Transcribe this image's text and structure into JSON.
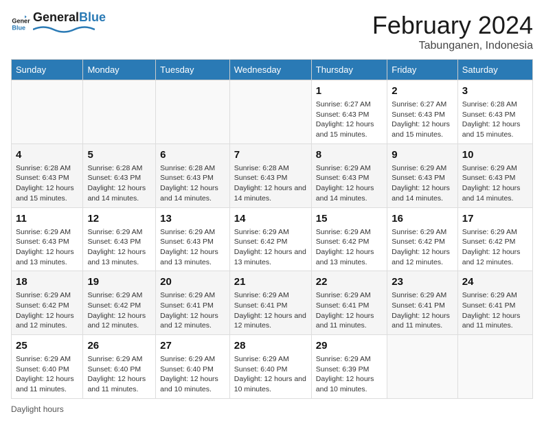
{
  "logo": {
    "text_general": "General",
    "text_blue": "Blue"
  },
  "title": "February 2024",
  "subtitle": "Tabunganen, Indonesia",
  "days_of_week": [
    "Sunday",
    "Monday",
    "Tuesday",
    "Wednesday",
    "Thursday",
    "Friday",
    "Saturday"
  ],
  "footer_text": "Daylight hours",
  "weeks": [
    [
      {
        "day": "",
        "info": ""
      },
      {
        "day": "",
        "info": ""
      },
      {
        "day": "",
        "info": ""
      },
      {
        "day": "",
        "info": ""
      },
      {
        "day": "1",
        "info": "Sunrise: 6:27 AM\nSunset: 6:43 PM\nDaylight: 12 hours and 15 minutes."
      },
      {
        "day": "2",
        "info": "Sunrise: 6:27 AM\nSunset: 6:43 PM\nDaylight: 12 hours and 15 minutes."
      },
      {
        "day": "3",
        "info": "Sunrise: 6:28 AM\nSunset: 6:43 PM\nDaylight: 12 hours and 15 minutes."
      }
    ],
    [
      {
        "day": "4",
        "info": "Sunrise: 6:28 AM\nSunset: 6:43 PM\nDaylight: 12 hours and 15 minutes."
      },
      {
        "day": "5",
        "info": "Sunrise: 6:28 AM\nSunset: 6:43 PM\nDaylight: 12 hours and 14 minutes."
      },
      {
        "day": "6",
        "info": "Sunrise: 6:28 AM\nSunset: 6:43 PM\nDaylight: 12 hours and 14 minutes."
      },
      {
        "day": "7",
        "info": "Sunrise: 6:28 AM\nSunset: 6:43 PM\nDaylight: 12 hours and 14 minutes."
      },
      {
        "day": "8",
        "info": "Sunrise: 6:29 AM\nSunset: 6:43 PM\nDaylight: 12 hours and 14 minutes."
      },
      {
        "day": "9",
        "info": "Sunrise: 6:29 AM\nSunset: 6:43 PM\nDaylight: 12 hours and 14 minutes."
      },
      {
        "day": "10",
        "info": "Sunrise: 6:29 AM\nSunset: 6:43 PM\nDaylight: 12 hours and 14 minutes."
      }
    ],
    [
      {
        "day": "11",
        "info": "Sunrise: 6:29 AM\nSunset: 6:43 PM\nDaylight: 12 hours and 13 minutes."
      },
      {
        "day": "12",
        "info": "Sunrise: 6:29 AM\nSunset: 6:43 PM\nDaylight: 12 hours and 13 minutes."
      },
      {
        "day": "13",
        "info": "Sunrise: 6:29 AM\nSunset: 6:43 PM\nDaylight: 12 hours and 13 minutes."
      },
      {
        "day": "14",
        "info": "Sunrise: 6:29 AM\nSunset: 6:42 PM\nDaylight: 12 hours and 13 minutes."
      },
      {
        "day": "15",
        "info": "Sunrise: 6:29 AM\nSunset: 6:42 PM\nDaylight: 12 hours and 13 minutes."
      },
      {
        "day": "16",
        "info": "Sunrise: 6:29 AM\nSunset: 6:42 PM\nDaylight: 12 hours and 12 minutes."
      },
      {
        "day": "17",
        "info": "Sunrise: 6:29 AM\nSunset: 6:42 PM\nDaylight: 12 hours and 12 minutes."
      }
    ],
    [
      {
        "day": "18",
        "info": "Sunrise: 6:29 AM\nSunset: 6:42 PM\nDaylight: 12 hours and 12 minutes."
      },
      {
        "day": "19",
        "info": "Sunrise: 6:29 AM\nSunset: 6:42 PM\nDaylight: 12 hours and 12 minutes."
      },
      {
        "day": "20",
        "info": "Sunrise: 6:29 AM\nSunset: 6:41 PM\nDaylight: 12 hours and 12 minutes."
      },
      {
        "day": "21",
        "info": "Sunrise: 6:29 AM\nSunset: 6:41 PM\nDaylight: 12 hours and 12 minutes."
      },
      {
        "day": "22",
        "info": "Sunrise: 6:29 AM\nSunset: 6:41 PM\nDaylight: 12 hours and 11 minutes."
      },
      {
        "day": "23",
        "info": "Sunrise: 6:29 AM\nSunset: 6:41 PM\nDaylight: 12 hours and 11 minutes."
      },
      {
        "day": "24",
        "info": "Sunrise: 6:29 AM\nSunset: 6:41 PM\nDaylight: 12 hours and 11 minutes."
      }
    ],
    [
      {
        "day": "25",
        "info": "Sunrise: 6:29 AM\nSunset: 6:40 PM\nDaylight: 12 hours and 11 minutes."
      },
      {
        "day": "26",
        "info": "Sunrise: 6:29 AM\nSunset: 6:40 PM\nDaylight: 12 hours and 11 minutes."
      },
      {
        "day": "27",
        "info": "Sunrise: 6:29 AM\nSunset: 6:40 PM\nDaylight: 12 hours and 10 minutes."
      },
      {
        "day": "28",
        "info": "Sunrise: 6:29 AM\nSunset: 6:40 PM\nDaylight: 12 hours and 10 minutes."
      },
      {
        "day": "29",
        "info": "Sunrise: 6:29 AM\nSunset: 6:39 PM\nDaylight: 12 hours and 10 minutes."
      },
      {
        "day": "",
        "info": ""
      },
      {
        "day": "",
        "info": ""
      }
    ]
  ]
}
